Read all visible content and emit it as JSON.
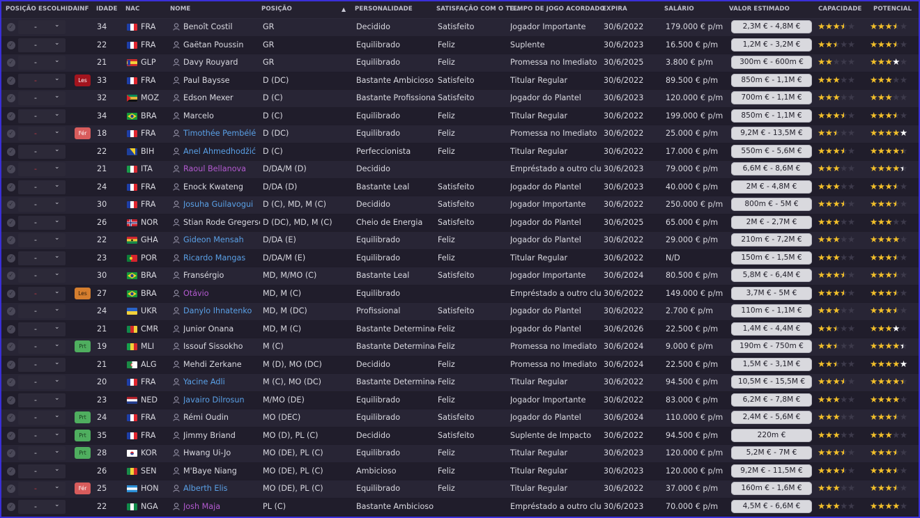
{
  "headers": {
    "posicao_escolhida": "POSIÇÃO ESCOLHIDA",
    "inf": "INF",
    "idade": "IDADE",
    "nac": "NAC",
    "nome": "NOME",
    "posicao": "POSIÇÃO",
    "personalidade": "PERSONALIDADE",
    "satisfacao": "SATISFAÇÃO COM O TE...",
    "tempo_jogo": "TEMPO DE JOGO ACORDADO",
    "expira": "EXPIRA",
    "salario": "SALÁRIO",
    "valor": "VALOR ESTIMADO",
    "capacidade": "CAPACIDADE",
    "potencial": "POTENCIAL"
  },
  "sort_indicator": "▲",
  "colors": {
    "frame_border": "#3a2fd9",
    "name_blue": "#5aa0e6",
    "name_purple": "#b35ad0",
    "star": "#f3c02a"
  },
  "players": [
    {
      "sel": "-",
      "sel_red": false,
      "badge": "",
      "age": "34",
      "flag": "fra",
      "nac": "FRA",
      "name": "Benoît Costil",
      "style": "normal",
      "pos": "GR",
      "pers": "Decidido",
      "sat": "Satisfeito",
      "time": "Jogador Importante",
      "exp": "30/6/2022",
      "sal": "179.000 € p/m",
      "val": "2,3M € - 4,8M €",
      "cap": 3.5,
      "pot": 3.5,
      "pot_white": false
    },
    {
      "sel": "-",
      "sel_red": false,
      "badge": "",
      "age": "22",
      "flag": "fra",
      "nac": "FRA",
      "name": "Gaëtan Poussin",
      "style": "normal",
      "pos": "GR",
      "pers": "Equilibrado",
      "sat": "Feliz",
      "time": "Suplente",
      "exp": "30/6/2023",
      "sal": "16.500 € p/m",
      "val": "1,2M € - 3,2M €",
      "cap": 2.5,
      "pot": 3.5,
      "pot_white": false
    },
    {
      "sel": "-",
      "sel_red": false,
      "badge": "",
      "age": "21",
      "flag": "glp",
      "nac": "GLP",
      "name": "Davy Rouyard",
      "style": "normal",
      "pos": "GR",
      "pers": "Equilibrado",
      "sat": "Feliz",
      "time": "Promessa no Imediato",
      "exp": "30/6/2025",
      "sal": "3.800 € p/m",
      "val": "300m € - 600m €",
      "cap": 2,
      "pot": 4,
      "pot_white": true
    },
    {
      "sel": "-",
      "sel_red": true,
      "badge": "Les",
      "badge_type": "les-red",
      "age": "33",
      "flag": "fra",
      "nac": "FRA",
      "name": "Paul Baysse",
      "style": "normal",
      "pos": "D (DC)",
      "pers": "Bastante Ambicioso",
      "sat": "Satisfeito",
      "time": "Titular Regular",
      "exp": "30/6/2022",
      "sal": "89.500 € p/m",
      "val": "850m € - 1,1M €",
      "cap": 3,
      "pot": 3,
      "pot_white": false
    },
    {
      "sel": "-",
      "sel_red": false,
      "badge": "",
      "age": "32",
      "flag": "moz",
      "nac": "MOZ",
      "name": "Edson Mexer",
      "style": "normal",
      "pos": "D (C)",
      "pers": "Bastante Profissional",
      "sat": "Satisfeito",
      "time": "Jogador do Plantel",
      "exp": "30/6/2023",
      "sal": "120.000 € p/m",
      "val": "700m € - 1,1M €",
      "cap": 3,
      "pot": 3,
      "pot_white": false
    },
    {
      "sel": "-",
      "sel_red": false,
      "badge": "",
      "age": "34",
      "flag": "bra",
      "nac": "BRA",
      "name": "Marcelo",
      "style": "normal",
      "pos": "D (C)",
      "pers": "Equilibrado",
      "sat": "Feliz",
      "time": "Titular Regular",
      "exp": "30/6/2022",
      "sal": "199.000 € p/m",
      "val": "850m € - 1,1M €",
      "cap": 3.5,
      "pot": 3.5,
      "pot_white": false
    },
    {
      "sel": "-",
      "sel_red": true,
      "badge": "Fér",
      "badge_type": "fer",
      "age": "18",
      "flag": "fra",
      "nac": "FRA",
      "name": "Timothée Pembélé",
      "style": "blue",
      "pos": "D (DC)",
      "pers": "Equilibrado",
      "sat": "Feliz",
      "time": "Promessa no Imediato",
      "exp": "30/6/2022",
      "sal": "25.000 € p/m",
      "val": "9,2M € - 13,5M €",
      "cap": 2.5,
      "pot": 5,
      "pot_white": true
    },
    {
      "sel": "-",
      "sel_red": false,
      "badge": "",
      "age": "22",
      "flag": "bih",
      "nac": "BIH",
      "name": "Anel Ahmedhodžić",
      "style": "blue",
      "pos": "D (C)",
      "pers": "Perfeccionista",
      "sat": "Feliz",
      "time": "Titular Regular",
      "exp": "30/6/2022",
      "sal": "17.000 € p/m",
      "val": "550m € - 5,6M €",
      "cap": 3.5,
      "pot": 4.5,
      "pot_white": false
    },
    {
      "sel": "-",
      "sel_red": true,
      "badge": "",
      "age": "21",
      "flag": "ita",
      "nac": "ITA",
      "name": "Raoul Bellanova",
      "style": "purple",
      "pos": "D/DA/M (D)",
      "pers": "Decidido",
      "sat": "",
      "time": "Empréstado a outro clube",
      "exp": "30/6/2023",
      "sal": "79.000 € p/m",
      "val": "6,6M € - 8,6M €",
      "cap": 3,
      "pot": 4.5,
      "pot_white": true
    },
    {
      "sel": "-",
      "sel_red": false,
      "badge": "",
      "age": "24",
      "flag": "fra",
      "nac": "FRA",
      "name": "Enock Kwateng",
      "style": "normal",
      "pos": "D/DA (D)",
      "pers": "Bastante Leal",
      "sat": "Satisfeito",
      "time": "Jogador do Plantel",
      "exp": "30/6/2023",
      "sal": "40.000 € p/m",
      "val": "2M € - 4,8M €",
      "cap": 3,
      "pot": 3.5,
      "pot_white": false
    },
    {
      "sel": "-",
      "sel_red": false,
      "badge": "",
      "age": "30",
      "flag": "fra",
      "nac": "FRA",
      "name": "Josuha Guilavogui",
      "style": "blue",
      "pos": "D (C), MD, M (C)",
      "pers": "Decidido",
      "sat": "Satisfeito",
      "time": "Jogador Importante",
      "exp": "30/6/2022",
      "sal": "250.000 € p/m",
      "val": "800m € - 5M €",
      "cap": 3.5,
      "pot": 3.5,
      "pot_white": false
    },
    {
      "sel": "-",
      "sel_red": false,
      "badge": "",
      "age": "26",
      "flag": "nor",
      "nac": "NOR",
      "name": "Stian Rode Gregersen",
      "style": "normal",
      "pos": "D (DC), MD, M (C)",
      "pers": "Cheio de Energia",
      "sat": "Satisfeito",
      "time": "Jogador do Plantel",
      "exp": "30/6/2025",
      "sal": "65.000 € p/m",
      "val": "2M € - 2,7M €",
      "cap": 3,
      "pot": 3,
      "pot_white": false
    },
    {
      "sel": "-",
      "sel_red": false,
      "badge": "",
      "age": "22",
      "flag": "gha",
      "nac": "GHA",
      "name": "Gideon Mensah",
      "style": "blue",
      "pos": "D/DA (E)",
      "pers": "Equilibrado",
      "sat": "Feliz",
      "time": "Jogador do Plantel",
      "exp": "30/6/2022",
      "sal": "29.000 € p/m",
      "val": "210m € - 7,2M €",
      "cap": 3,
      "pot": 4,
      "pot_white": false
    },
    {
      "sel": "-",
      "sel_red": false,
      "badge": "",
      "age": "23",
      "flag": "por",
      "nac": "POR",
      "name": "Ricardo Mangas",
      "style": "blue",
      "pos": "D/DA/M (E)",
      "pers": "Equilibrado",
      "sat": "Feliz",
      "time": "Titular Regular",
      "exp": "30/6/2022",
      "sal": "N/D",
      "val": "150m € - 1,5M €",
      "cap": 3,
      "pot": 3.5,
      "pot_white": false
    },
    {
      "sel": "-",
      "sel_red": false,
      "badge": "",
      "age": "30",
      "flag": "bra",
      "nac": "BRA",
      "name": "Fransérgio",
      "style": "normal",
      "pos": "MD, M/MO (C)",
      "pers": "Bastante Leal",
      "sat": "Satisfeito",
      "time": "Jogador Importante",
      "exp": "30/6/2024",
      "sal": "80.500 € p/m",
      "val": "5,8M € - 6,4M €",
      "cap": 3.5,
      "pot": 3.5,
      "pot_white": false
    },
    {
      "sel": "-",
      "sel_red": true,
      "badge": "Les",
      "badge_type": "les-orange",
      "age": "27",
      "flag": "bra",
      "nac": "BRA",
      "name": "Otávio",
      "style": "purple",
      "pos": "MD, M (C)",
      "pers": "Equilibrado",
      "sat": "",
      "time": "Empréstado a outro clube",
      "exp": "30/6/2022",
      "sal": "149.000 € p/m",
      "val": "3,7M € - 5M €",
      "cap": 3.5,
      "pot": 3.5,
      "pot_white": false
    },
    {
      "sel": "-",
      "sel_red": false,
      "badge": "",
      "age": "24",
      "flag": "ukr",
      "nac": "UKR",
      "name": "Danylo Ihnatenko",
      "style": "blue",
      "pos": "MD, M (DC)",
      "pers": "Profissional",
      "sat": "Satisfeito",
      "time": "Jogador do Plantel",
      "exp": "30/6/2022",
      "sal": "2.700 € p/m",
      "val": "110m € - 1,1M €",
      "cap": 3,
      "pot": 3.5,
      "pot_white": false
    },
    {
      "sel": "-",
      "sel_red": false,
      "badge": "",
      "age": "21",
      "flag": "cmr",
      "nac": "CMR",
      "name": "Junior Onana",
      "style": "normal",
      "pos": "MD, M (C)",
      "pers": "Bastante Determinado",
      "sat": "Feliz",
      "time": "Jogador do Plantel",
      "exp": "30/6/2026",
      "sal": "22.500 € p/m",
      "val": "1,4M € - 4,4M €",
      "cap": 2.5,
      "pot": 4,
      "pot_white": true
    },
    {
      "sel": "-",
      "sel_red": false,
      "badge": "Prt",
      "badge_type": "prt",
      "age": "19",
      "flag": "mli",
      "nac": "MLI",
      "name": "Issouf Sissokho",
      "style": "normal",
      "pos": "M (C)",
      "pers": "Bastante Determinado",
      "sat": "Feliz",
      "time": "Promessa no Imediato",
      "exp": "30/6/2024",
      "sal": "9.000 € p/m",
      "val": "190m € - 750m €",
      "cap": 2.5,
      "pot": 4.5,
      "pot_white": true
    },
    {
      "sel": "-",
      "sel_red": false,
      "badge": "",
      "age": "21",
      "flag": "alg",
      "nac": "ALG",
      "name": "Mehdi Zerkane",
      "style": "normal",
      "pos": "M (D), MO (DC)",
      "pers": "Decidido",
      "sat": "Feliz",
      "time": "Promessa no Imediato",
      "exp": "30/6/2024",
      "sal": "22.500 € p/m",
      "val": "1,5M € - 3,1M €",
      "cap": 2.5,
      "pot": 5,
      "pot_white": true
    },
    {
      "sel": "-",
      "sel_red": false,
      "badge": "",
      "age": "20",
      "flag": "fra",
      "nac": "FRA",
      "name": "Yacine Adli",
      "style": "blue",
      "pos": "M (C), MO (DC)",
      "pers": "Bastante Determinado",
      "sat": "Feliz",
      "time": "Titular Regular",
      "exp": "30/6/2022",
      "sal": "94.500 € p/m",
      "val": "10,5M € - 15,5M €",
      "cap": 3.5,
      "pot": 4.5,
      "pot_white": false
    },
    {
      "sel": "-",
      "sel_red": false,
      "badge": "",
      "age": "23",
      "flag": "ned",
      "nac": "NED",
      "name": "Javairo Dilrosun",
      "style": "blue",
      "pos": "M/MO (DE)",
      "pers": "Equilibrado",
      "sat": "Feliz",
      "time": "Jogador Importante",
      "exp": "30/6/2022",
      "sal": "83.000 € p/m",
      "val": "6,2M € - 7,8M €",
      "cap": 3,
      "pot": 4,
      "pot_white": false
    },
    {
      "sel": "-",
      "sel_red": false,
      "badge": "Prt",
      "badge_type": "prt",
      "age": "24",
      "flag": "fra",
      "nac": "FRA",
      "name": "Rémi Oudin",
      "style": "normal",
      "pos": "MO (DEC)",
      "pers": "Equilibrado",
      "sat": "Satisfeito",
      "time": "Jogador do Plantel",
      "exp": "30/6/2024",
      "sal": "110.000 € p/m",
      "val": "2,4M € - 5,6M €",
      "cap": 3,
      "pot": 3.5,
      "pot_white": false
    },
    {
      "sel": "-",
      "sel_red": false,
      "badge": "Prt",
      "badge_type": "prt",
      "age": "35",
      "flag": "fra",
      "nac": "FRA",
      "name": "Jimmy Briand",
      "style": "normal",
      "pos": "MO (D), PL (C)",
      "pers": "Decidido",
      "sat": "Satisfeito",
      "time": "Suplente de Impacto",
      "exp": "30/6/2022",
      "sal": "94.500 € p/m",
      "val": "220m €",
      "cap": 3,
      "pot": 3,
      "pot_white": false
    },
    {
      "sel": "-",
      "sel_red": false,
      "badge": "Prt",
      "badge_type": "prt",
      "age": "28",
      "flag": "kor",
      "nac": "KOR",
      "name": "Hwang Ui-Jo",
      "style": "normal",
      "pos": "MO (DE), PL (C)",
      "pers": "Equilibrado",
      "sat": "Feliz",
      "time": "Titular Regular",
      "exp": "30/6/2023",
      "sal": "120.000 € p/m",
      "val": "5,2M € - 7M €",
      "cap": 3.5,
      "pot": 3.5,
      "pot_white": false
    },
    {
      "sel": "-",
      "sel_red": false,
      "badge": "",
      "age": "26",
      "flag": "sen",
      "nac": "SEN",
      "name": "M'Baye Niang",
      "style": "normal",
      "pos": "MO (DE), PL (C)",
      "pers": "Ambicioso",
      "sat": "Feliz",
      "time": "Titular Regular",
      "exp": "30/6/2023",
      "sal": "120.000 € p/m",
      "val": "9,2M € - 11,5M €",
      "cap": 3.5,
      "pot": 3.5,
      "pot_white": false
    },
    {
      "sel": "-",
      "sel_red": true,
      "badge": "Fér",
      "badge_type": "fer",
      "age": "25",
      "flag": "hon",
      "nac": "HON",
      "name": "Alberth Elis",
      "style": "blue",
      "pos": "MO (DE), PL (C)",
      "pers": "Equilibrado",
      "sat": "Feliz",
      "time": "Titular Regular",
      "exp": "30/6/2022",
      "sal": "37.000 € p/m",
      "val": "160m € - 1,6M €",
      "cap": 3,
      "pot": 3.5,
      "pot_white": false
    },
    {
      "sel": "-",
      "sel_red": false,
      "badge": "",
      "age": "22",
      "flag": "nga",
      "nac": "NGA",
      "name": "Josh Maja",
      "style": "purple",
      "pos": "PL (C)",
      "pers": "Bastante Ambicioso",
      "sat": "",
      "time": "Empréstado a outro clube",
      "exp": "30/6/2023",
      "sal": "70.000 € p/m",
      "val": "4,5M € - 6,6M €",
      "cap": 3,
      "pot": 4,
      "pot_white": false
    }
  ]
}
